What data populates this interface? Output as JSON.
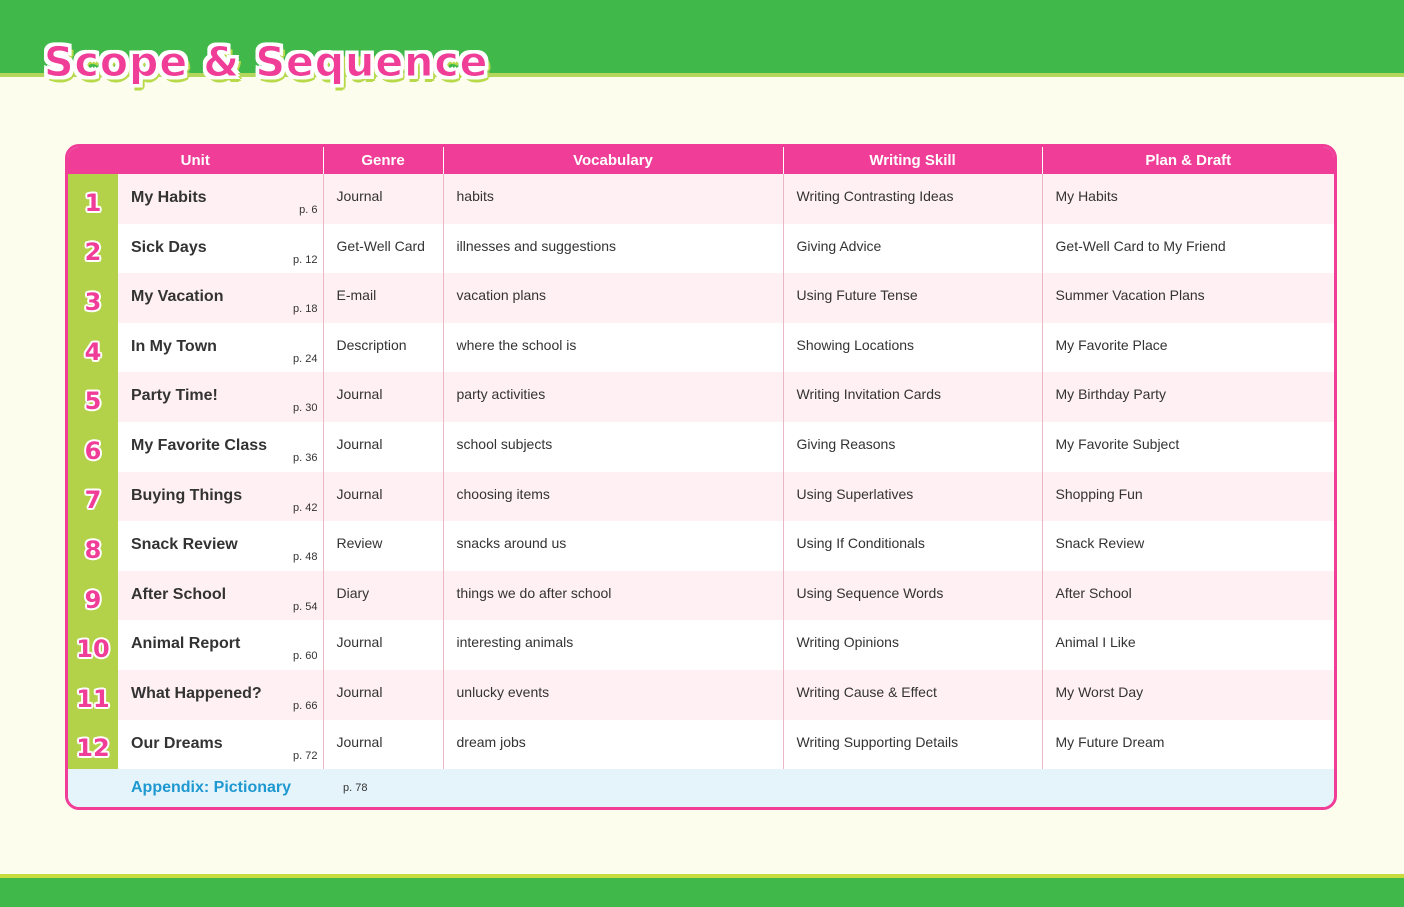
{
  "title": "Scope & Sequence",
  "colors": {
    "brand_pink": "#ef3d98",
    "green_band": "#40b84a",
    "lime": "#b4d14a",
    "appendix_blue": "#1e98d0"
  },
  "headers": {
    "unit": "Unit",
    "genre": "Genre",
    "vocabulary": "Vocabulary",
    "writing_skill": "Writing Skill",
    "plan_draft": "Plan & Draft"
  },
  "units": [
    {
      "num": "1",
      "title": "My Habits",
      "page": "p. 6",
      "genre": "Journal",
      "vocabulary": "habits",
      "skill": "Writing Contrasting Ideas",
      "plan": "My Habits"
    },
    {
      "num": "2",
      "title": "Sick Days",
      "page": "p. 12",
      "genre": "Get-Well Card",
      "vocabulary": "illnesses and suggestions",
      "skill": "Giving Advice",
      "plan": "Get-Well Card to My Friend"
    },
    {
      "num": "3",
      "title": "My Vacation",
      "page": "p. 18",
      "genre": "E-mail",
      "vocabulary": "vacation plans",
      "skill": "Using Future Tense",
      "plan": "Summer Vacation Plans"
    },
    {
      "num": "4",
      "title": "In My Town",
      "page": "p. 24",
      "genre": "Description",
      "vocabulary": "where the school is",
      "skill": "Showing Locations",
      "plan": "My Favorite Place"
    },
    {
      "num": "5",
      "title": "Party Time!",
      "page": "p. 30",
      "genre": "Journal",
      "vocabulary": "party activities",
      "skill": "Writing Invitation Cards",
      "plan": "My Birthday Party"
    },
    {
      "num": "6",
      "title": "My Favorite Class",
      "page": "p. 36",
      "genre": "Journal",
      "vocabulary": "school subjects",
      "skill": "Giving Reasons",
      "plan": "My Favorite Subject"
    },
    {
      "num": "7",
      "title": "Buying Things",
      "page": "p. 42",
      "genre": "Journal",
      "vocabulary": "choosing items",
      "skill": "Using Superlatives",
      "plan": "Shopping Fun"
    },
    {
      "num": "8",
      "title": "Snack Review",
      "page": "p. 48",
      "genre": "Review",
      "vocabulary": "snacks around us",
      "skill": "Using If Conditionals",
      "plan": "Snack Review"
    },
    {
      "num": "9",
      "title": "After School",
      "page": "p. 54",
      "genre": "Diary",
      "vocabulary": "things we do after school",
      "skill": "Using Sequence Words",
      "plan": "After School"
    },
    {
      "num": "10",
      "title": "Animal Report",
      "page": "p. 60",
      "genre": "Journal",
      "vocabulary": "interesting animals",
      "skill": "Writing Opinions",
      "plan": "Animal I Like"
    },
    {
      "num": "11",
      "title": "What Happened?",
      "page": "p. 66",
      "genre": "Journal",
      "vocabulary": "unlucky events",
      "skill": "Writing Cause & Effect",
      "plan": "My Worst Day"
    },
    {
      "num": "12",
      "title": "Our Dreams",
      "page": "p. 72",
      "genre": "Journal",
      "vocabulary": "dream jobs",
      "skill": "Writing Supporting Details",
      "plan": "My Future Dream"
    }
  ],
  "appendix": {
    "label": "Appendix: Pictionary",
    "page": "p. 78"
  }
}
